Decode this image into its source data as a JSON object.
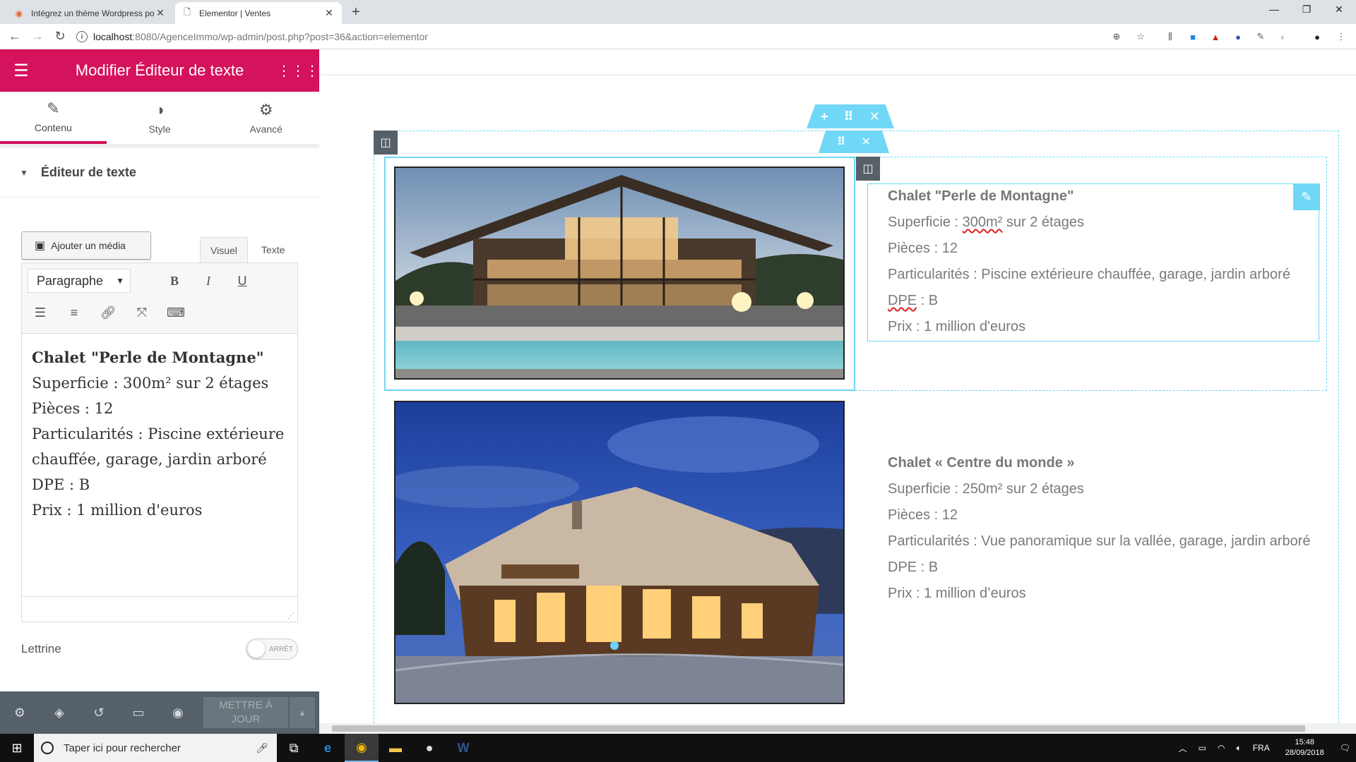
{
  "browser": {
    "tabs": [
      {
        "title": "Intégrez un thème Wordpress po",
        "active": false
      },
      {
        "title": "Elementor | Ventes",
        "active": true
      }
    ],
    "url_host": "localhost",
    "url_path": ":8080/AgenceImmo/wp-admin/post.php?post=36&action=elementor",
    "window_controls": [
      "—",
      "❐",
      "✕"
    ]
  },
  "panel": {
    "title": "Modifier Éditeur de texte",
    "tabs": [
      {
        "label": "Contenu",
        "icon": "pencil-icon"
      },
      {
        "label": "Style",
        "icon": "contrast-icon"
      },
      {
        "label": "Avancé",
        "icon": "gear-icon"
      }
    ],
    "section_title": "Éditeur de texte",
    "add_media_label": "Ajouter un média",
    "editor_tabs": [
      "Visuel",
      "Texte"
    ],
    "format_select": "Paragraphe",
    "editor_content": {
      "title": "Chalet \"Perle de Montagne\"",
      "lines": [
        "Superficie : 300m² sur 2 étages",
        "Pièces : 12",
        "Particularités : Piscine extérieure chauffée, garage, jardin arboré",
        "DPE : B",
        "Prix : 1 million d'euros"
      ]
    },
    "dropcap_label": "Lettrine",
    "dropcap_state": "ARRÊT",
    "update_label": "METTRE À JOUR"
  },
  "canvas": {
    "listing1": {
      "name": "Chalet \"Perle de Montagne\"",
      "area_prefix": "Superficie : ",
      "area_value": "300m²",
      "area_suffix": " sur 2 étages",
      "rooms": "Pièces : 12",
      "features": "Particularités : Piscine extérieure chauffée, garage, jardin arboré",
      "dpe_label": "DPE",
      "dpe_value": " : B",
      "price": "Prix : 1 million d'euros"
    },
    "listing2": {
      "name": "Chalet « Centre du monde »",
      "area": "Superficie : 250m² sur 2 étages",
      "rooms": "Pièces : 12",
      "features": "Particularités : Vue panoramique sur la vallée, garage, jardin arboré",
      "dpe": "DPE : B",
      "price": "Prix : 1 million d’euros"
    }
  },
  "taskbar": {
    "search_placeholder": "Taper ici pour rechercher",
    "language": "FRA",
    "time": "15:48",
    "date": "28/09/2018"
  },
  "colors": {
    "brand": "#d5125c",
    "highlight": "#71d7f7",
    "panel_footer": "#556068"
  }
}
